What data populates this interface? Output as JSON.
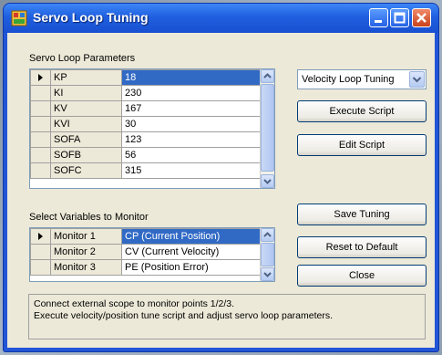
{
  "window": {
    "title": "Servo Loop Tuning"
  },
  "params_group": {
    "label": "Servo Loop Parameters",
    "rows": [
      {
        "name": "KP",
        "value": "18",
        "selected": true
      },
      {
        "name": "KI",
        "value": "230"
      },
      {
        "name": "KV",
        "value": "167"
      },
      {
        "name": "KVI",
        "value": "30"
      },
      {
        "name": "SOFA",
        "value": "123"
      },
      {
        "name": "SOFB",
        "value": "56"
      },
      {
        "name": "SOFC",
        "value": "315"
      }
    ]
  },
  "monitor_group": {
    "label": "Select Variables to Monitor",
    "rows": [
      {
        "name": "Monitor 1",
        "value": "CP (Current Position)",
        "selected": true
      },
      {
        "name": "Monitor 2",
        "value": "CV (Current Velocity)"
      },
      {
        "name": "Monitor 3",
        "value": "PE (Position Error)"
      }
    ]
  },
  "controls": {
    "mode_select": "Velocity Loop Tuning",
    "execute_script": "Execute Script",
    "edit_script": "Edit Script",
    "save_tuning": "Save Tuning",
    "reset_default": "Reset to Default",
    "close": "Close"
  },
  "status": {
    "line1": "Connect external scope to monitor points 1/2/3.",
    "line2": "Execute velocity/position tune script and adjust servo loop parameters."
  },
  "colors": {
    "titlebar": "#1f5fe0",
    "selection": "#316ac5",
    "client_bg": "#ece9d8"
  }
}
